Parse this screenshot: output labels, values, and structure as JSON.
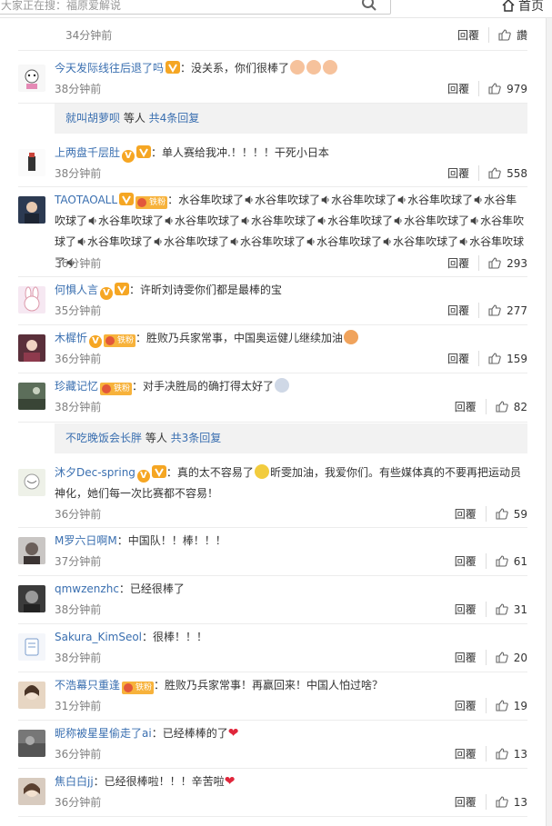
{
  "topbar": {
    "search_placeholder": "大家正在搜：福原爱解说",
    "home_label": "首页"
  },
  "previous_comment": {
    "time": "34分钟前",
    "reply_label": "回覆",
    "like_count": "讚"
  },
  "comments": [
    {
      "user": "今天发际线往后退了吗",
      "text": "：没关系，你们很棒了",
      "emoji": [
        "pig-face",
        "pig-face",
        "pig-face"
      ],
      "time": "38分钟前",
      "reply_label": "回覆",
      "likes": "979"
    },
    {
      "user": "上两盘千层肚",
      "text": "：单人赛给我冲.！！！！干死小日本",
      "time": "38分钟前",
      "reply_label": "回覆",
      "likes": "558"
    },
    {
      "user": "TAOTAOALL",
      "text": "：水谷隼吹球了",
      "repeat": [
        "水谷隼吹球了",
        "水谷隼吹球了",
        "水谷隼吹球了",
        "水谷隼吹球了",
        "水谷隼吹球了",
        "水谷隼吹球了",
        "水谷隼吹球了",
        "水谷隼吹球了",
        "水谷隼吹球了",
        "水谷隼吹球了",
        "水谷隼吹球了",
        "水谷隼吹球了",
        "水谷隼吹球了",
        "水谷隼吹球了",
        "水谷隼吹球了",
        "水谷隼吹球了"
      ],
      "time": "36分钟前",
      "reply_label": "回覆",
      "likes": "293"
    },
    {
      "user": "何惧人言",
      "text": "：许昕刘诗雯你们都是最棒的宝",
      "time": "35分钟前",
      "reply_label": "回覆",
      "likes": "277"
    },
    {
      "user": "木樨忻",
      "text": "：胜败乃兵家常事，中国奥运健儿继续加油",
      "time": "36分钟前",
      "reply_label": "回覆",
      "likes": "159"
    },
    {
      "user": "珍藏记忆",
      "text": "：对手决胜局的确打得太好了",
      "time": "38分钟前",
      "reply_label": "回覆",
      "likes": "82"
    },
    {
      "user": "沐夕Dec-spring",
      "text": "：真的太不容易了",
      "text2": "昕雯加油，我爱你们。有些媒体真的不要再把运动员神化，她们每一次比赛都不容易！",
      "time": "36分钟前",
      "reply_label": "回覆",
      "likes": "59"
    },
    {
      "user": "M罗六日啊M",
      "text": "：中国队！！棒！！！",
      "time": "37分钟前",
      "reply_label": "回覆",
      "likes": "61"
    },
    {
      "user": "qmwzenzhc",
      "text": "：已经很棒了",
      "time": "38分钟前",
      "reply_label": "回覆",
      "likes": "31"
    },
    {
      "user": "Sakura_KimSeol",
      "text": "：很棒！！！",
      "time": "38分钟前",
      "reply_label": "回覆",
      "likes": "20"
    },
    {
      "user": "不浩幕只重逢",
      "text": "：胜败乃兵家常事！再赢回来！中国人怕过啥？",
      "time": "31分钟前",
      "reply_label": "回覆",
      "likes": "19"
    },
    {
      "user": "昵称被星星偷走了ai",
      "text": "：已经棒棒的了",
      "time": "36分钟前",
      "reply_label": "回覆",
      "likes": "13"
    },
    {
      "user": "焦白白jj",
      "text": "：已经很棒啦！！！辛苦啦",
      "time": "36分钟前",
      "reply_label": "回覆",
      "likes": "13"
    }
  ],
  "reply_summaries": [
    {
      "name": "就叫胡萝呗",
      "suffix": " 等人 ",
      "count_link": "共4条回复"
    },
    {
      "name": "不吃晚饭会长胖",
      "suffix": " 等人 ",
      "count_link": "共3条回复"
    }
  ],
  "badges": {
    "vip_text": "V",
    "fans_text": "铁粉"
  },
  "colors": {
    "username": "#eb7350",
    "link": "#3a6fb0",
    "reply_box_bg": "#f2f2f2",
    "heart": "#e0263b"
  }
}
